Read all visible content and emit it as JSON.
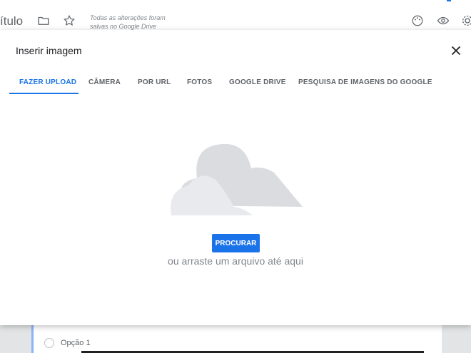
{
  "app": {
    "title": "ítulo",
    "save_status": "Todas as alterações foram salvas no Google Drive"
  },
  "dialog": {
    "title": "Inserir imagem",
    "tabs": [
      {
        "label": "FAZER UPLOAD",
        "active": true
      },
      {
        "label": "CÂMERA",
        "active": false
      },
      {
        "label": "POR URL",
        "active": false
      },
      {
        "label": "FOTOS",
        "active": false
      },
      {
        "label": "GOOGLE DRIVE",
        "active": false
      },
      {
        "label": "PESQUISA DE IMAGENS DO GOOGLE",
        "active": false
      }
    ],
    "browse_button": "PROCURAR",
    "drop_text": "ou arraste um arquivo até aqui"
  },
  "form": {
    "option_label": "Opção 1"
  },
  "colors": {
    "accent": "#1a73e8",
    "cloud_back": "#dadce0",
    "cloud_front": "#e8eaed"
  }
}
